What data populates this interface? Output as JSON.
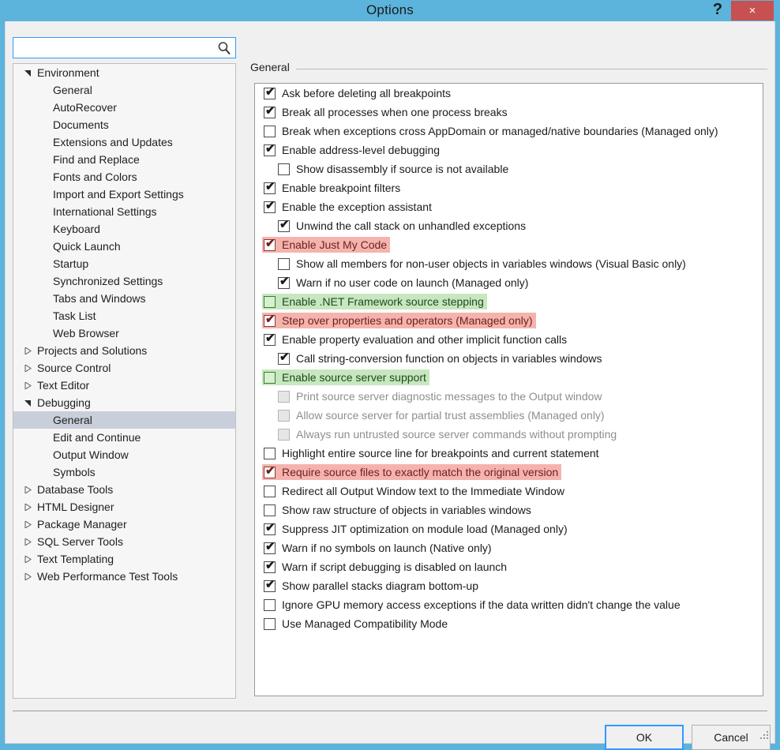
{
  "window": {
    "title": "Options",
    "help_label": "?",
    "close_label": "×",
    "accent_color": "#5cb3dc",
    "close_color": "#c75050"
  },
  "search": {
    "value": "",
    "placeholder": "",
    "icon": "search-icon"
  },
  "tree": {
    "items": [
      {
        "label": "Environment",
        "level": 0,
        "twisty": "expanded",
        "selected": false
      },
      {
        "label": "General",
        "level": 1,
        "twisty": "none",
        "selected": false
      },
      {
        "label": "AutoRecover",
        "level": 1,
        "twisty": "none",
        "selected": false
      },
      {
        "label": "Documents",
        "level": 1,
        "twisty": "none",
        "selected": false
      },
      {
        "label": "Extensions and Updates",
        "level": 1,
        "twisty": "none",
        "selected": false
      },
      {
        "label": "Find and Replace",
        "level": 1,
        "twisty": "none",
        "selected": false
      },
      {
        "label": "Fonts and Colors",
        "level": 1,
        "twisty": "none",
        "selected": false
      },
      {
        "label": "Import and Export Settings",
        "level": 1,
        "twisty": "none",
        "selected": false
      },
      {
        "label": "International Settings",
        "level": 1,
        "twisty": "none",
        "selected": false
      },
      {
        "label": "Keyboard",
        "level": 1,
        "twisty": "none",
        "selected": false
      },
      {
        "label": "Quick Launch",
        "level": 1,
        "twisty": "none",
        "selected": false
      },
      {
        "label": "Startup",
        "level": 1,
        "twisty": "none",
        "selected": false
      },
      {
        "label": "Synchronized Settings",
        "level": 1,
        "twisty": "none",
        "selected": false
      },
      {
        "label": "Tabs and Windows",
        "level": 1,
        "twisty": "none",
        "selected": false
      },
      {
        "label": "Task List",
        "level": 1,
        "twisty": "none",
        "selected": false
      },
      {
        "label": "Web Browser",
        "level": 1,
        "twisty": "none",
        "selected": false
      },
      {
        "label": "Projects and Solutions",
        "level": 0,
        "twisty": "collapsed",
        "selected": false
      },
      {
        "label": "Source Control",
        "level": 0,
        "twisty": "collapsed",
        "selected": false
      },
      {
        "label": "Text Editor",
        "level": 0,
        "twisty": "collapsed",
        "selected": false
      },
      {
        "label": "Debugging",
        "level": 0,
        "twisty": "expanded",
        "selected": false
      },
      {
        "label": "General",
        "level": 1,
        "twisty": "none",
        "selected": true
      },
      {
        "label": "Edit and Continue",
        "level": 1,
        "twisty": "none",
        "selected": false
      },
      {
        "label": "Output Window",
        "level": 1,
        "twisty": "none",
        "selected": false
      },
      {
        "label": "Symbols",
        "level": 1,
        "twisty": "none",
        "selected": false
      },
      {
        "label": "Database Tools",
        "level": 0,
        "twisty": "collapsed",
        "selected": false
      },
      {
        "label": "HTML Designer",
        "level": 0,
        "twisty": "collapsed",
        "selected": false
      },
      {
        "label": "Package Manager",
        "level": 0,
        "twisty": "collapsed",
        "selected": false
      },
      {
        "label": "SQL Server Tools",
        "level": 0,
        "twisty": "collapsed",
        "selected": false
      },
      {
        "label": "Text Templating",
        "level": 0,
        "twisty": "collapsed",
        "selected": false
      },
      {
        "label": "Web Performance Test Tools",
        "level": 0,
        "twisty": "collapsed",
        "selected": false
      }
    ]
  },
  "pane": {
    "group_label": "General",
    "highlight_pink": "#f5b3ae",
    "highlight_green": "#c6e7bf",
    "options": [
      {
        "label": "Ask before deleting all breakpoints",
        "checked": true,
        "indent": 0,
        "disabled": false,
        "highlight": "none"
      },
      {
        "label": "Break all processes when one process breaks",
        "checked": true,
        "indent": 0,
        "disabled": false,
        "highlight": "none"
      },
      {
        "label": "Break when exceptions cross AppDomain or managed/native boundaries (Managed only)",
        "checked": false,
        "indent": 0,
        "disabled": false,
        "highlight": "none"
      },
      {
        "label": "Enable address-level debugging",
        "checked": true,
        "indent": 0,
        "disabled": false,
        "highlight": "none"
      },
      {
        "label": "Show disassembly if source is not available",
        "checked": false,
        "indent": 1,
        "disabled": false,
        "highlight": "none"
      },
      {
        "label": "Enable breakpoint filters",
        "checked": true,
        "indent": 0,
        "disabled": false,
        "highlight": "none"
      },
      {
        "label": "Enable the exception assistant",
        "checked": true,
        "indent": 0,
        "disabled": false,
        "highlight": "none"
      },
      {
        "label": "Unwind the call stack on unhandled exceptions",
        "checked": true,
        "indent": 1,
        "disabled": false,
        "highlight": "none"
      },
      {
        "label": "Enable Just My Code",
        "checked": true,
        "indent": 0,
        "disabled": false,
        "highlight": "pink"
      },
      {
        "label": "Show all members for non-user objects in variables windows (Visual Basic only)",
        "checked": false,
        "indent": 1,
        "disabled": false,
        "highlight": "none"
      },
      {
        "label": "Warn if no user code on launch (Managed only)",
        "checked": true,
        "indent": 1,
        "disabled": false,
        "highlight": "none"
      },
      {
        "label": "Enable .NET Framework source stepping",
        "checked": false,
        "indent": 0,
        "disabled": false,
        "highlight": "green"
      },
      {
        "label": "Step over properties and operators (Managed only)",
        "checked": true,
        "indent": 0,
        "disabled": false,
        "highlight": "pink"
      },
      {
        "label": "Enable property evaluation and other implicit function calls",
        "checked": true,
        "indent": 0,
        "disabled": false,
        "highlight": "none"
      },
      {
        "label": "Call string-conversion function on objects in variables windows",
        "checked": true,
        "indent": 1,
        "disabled": false,
        "highlight": "none"
      },
      {
        "label": "Enable source server support",
        "checked": false,
        "indent": 0,
        "disabled": false,
        "highlight": "green"
      },
      {
        "label": "Print source server diagnostic messages to the Output window",
        "checked": false,
        "indent": 1,
        "disabled": true,
        "highlight": "none"
      },
      {
        "label": "Allow source server for partial trust assemblies (Managed only)",
        "checked": false,
        "indent": 1,
        "disabled": true,
        "highlight": "none"
      },
      {
        "label": "Always run untrusted source server commands without prompting",
        "checked": false,
        "indent": 1,
        "disabled": true,
        "highlight": "none"
      },
      {
        "label": "Highlight entire source line for breakpoints and current statement",
        "checked": false,
        "indent": 0,
        "disabled": false,
        "highlight": "none"
      },
      {
        "label": "Require source files to exactly match the original version",
        "checked": true,
        "indent": 0,
        "disabled": false,
        "highlight": "pink"
      },
      {
        "label": "Redirect all Output Window text to the Immediate Window",
        "checked": false,
        "indent": 0,
        "disabled": false,
        "highlight": "none"
      },
      {
        "label": "Show raw structure of objects in variables windows",
        "checked": false,
        "indent": 0,
        "disabled": false,
        "highlight": "none"
      },
      {
        "label": "Suppress JIT optimization on module load (Managed only)",
        "checked": true,
        "indent": 0,
        "disabled": false,
        "highlight": "none"
      },
      {
        "label": "Warn if no symbols on launch (Native only)",
        "checked": true,
        "indent": 0,
        "disabled": false,
        "highlight": "none"
      },
      {
        "label": "Warn if script debugging is disabled on launch",
        "checked": true,
        "indent": 0,
        "disabled": false,
        "highlight": "none"
      },
      {
        "label": "Show parallel stacks diagram bottom-up",
        "checked": true,
        "indent": 0,
        "disabled": false,
        "highlight": "none"
      },
      {
        "label": "Ignore GPU memory access exceptions if the data written didn't change the value",
        "checked": false,
        "indent": 0,
        "disabled": false,
        "highlight": "none"
      },
      {
        "label": "Use Managed Compatibility Mode",
        "checked": false,
        "indent": 0,
        "disabled": false,
        "highlight": "none"
      }
    ]
  },
  "footer": {
    "ok_label": "OK",
    "cancel_label": "Cancel"
  }
}
